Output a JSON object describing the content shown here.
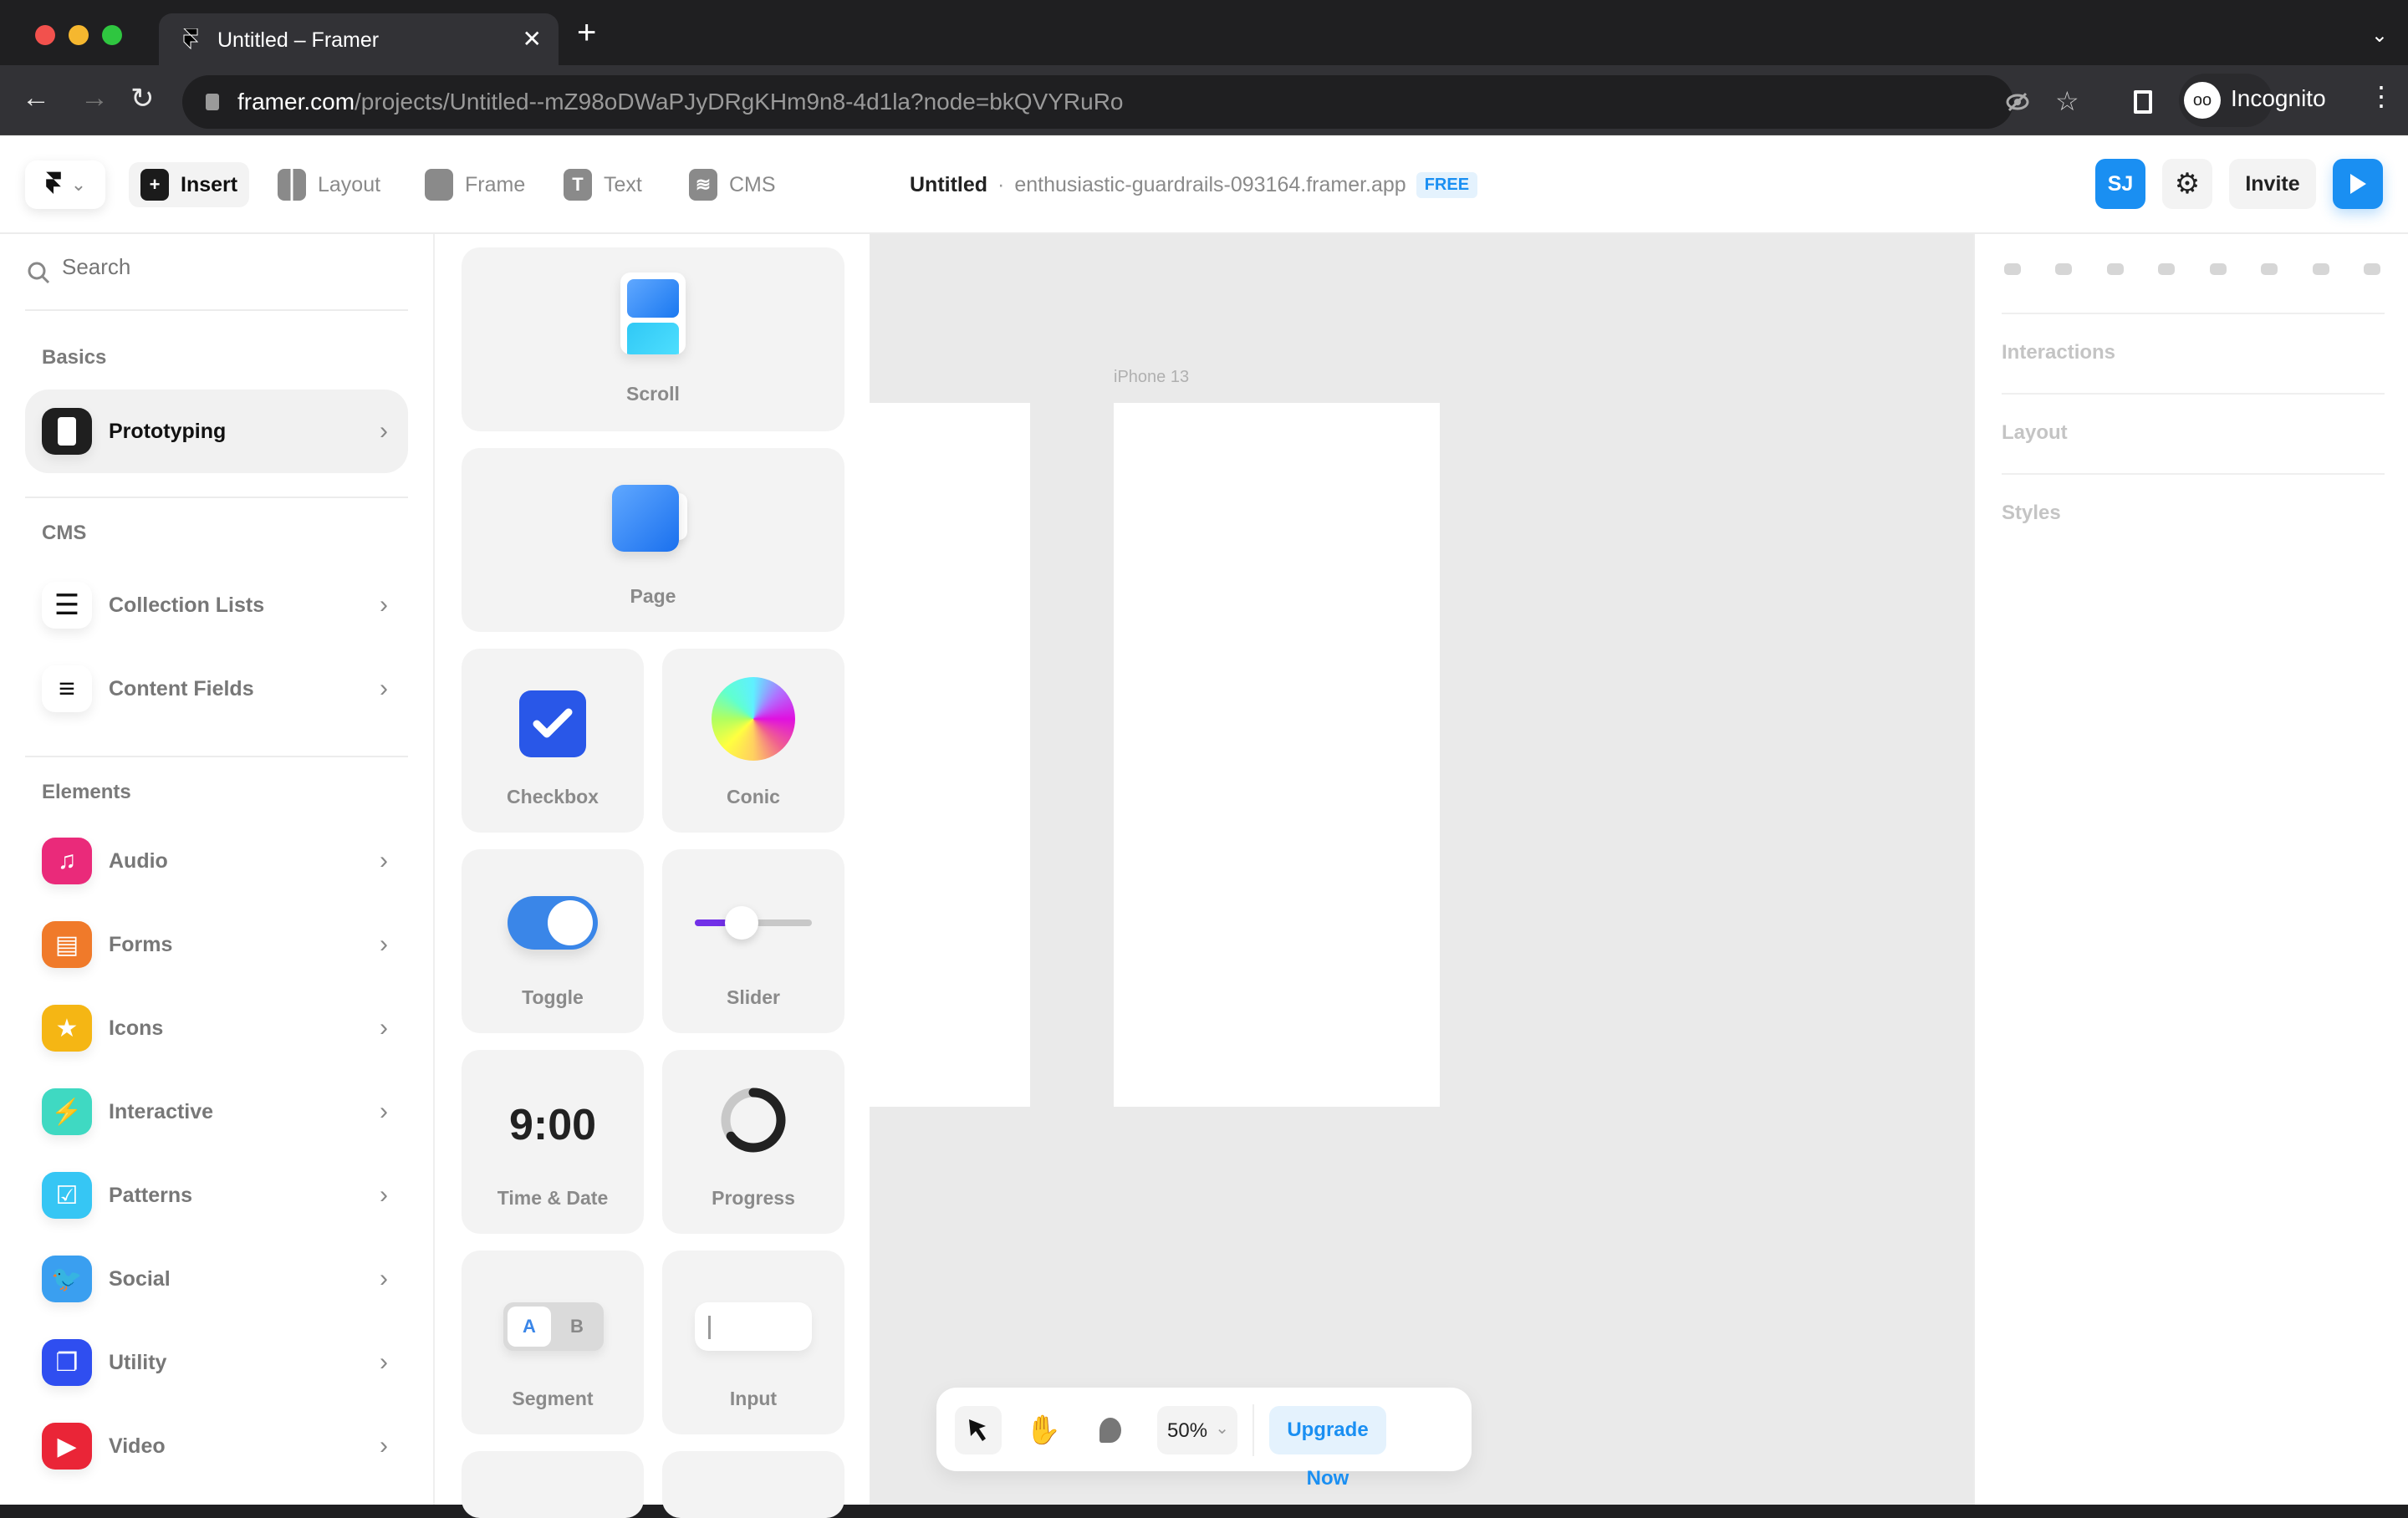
{
  "browser": {
    "tab_title": "Untitled – Framer",
    "url_host": "framer.com",
    "url_path": "/projects/Untitled--mZ98oDWaPJyDRgKHm9n8-4d1la?node=bkQVYRuRo",
    "profile_label": "Incognito",
    "icons": [
      "framer-favicon",
      "close-icon",
      "plus-icon",
      "chevron-down-icon",
      "back-icon",
      "forward-icon",
      "reload-icon",
      "lock-icon",
      "eye-off-icon",
      "star-icon",
      "sidebar-icon",
      "incognito-icon",
      "more-icon"
    ]
  },
  "topbar": {
    "insert": "Insert",
    "layout": "Layout",
    "frame": "Frame",
    "text": "Text",
    "cms": "CMS",
    "project_name": "Untitled",
    "separator": "·",
    "domain": "enthusiastic-guardrails-093164.framer.app",
    "plan_badge": "FREE",
    "avatar_initials": "SJ",
    "invite": "Invite",
    "accent": "#1a8ff2"
  },
  "sidebar": {
    "search_placeholder": "Search",
    "sections": {
      "basics": "Basics",
      "cms": "CMS",
      "elements": "Elements"
    },
    "basics_items": [
      {
        "label": "Prototyping",
        "icon": "phone-icon",
        "color": "#1f1f1f"
      }
    ],
    "cms_items": [
      {
        "label": "Collection Lists",
        "icon": "database-icon"
      },
      {
        "label": "Content Fields",
        "icon": "lines-icon"
      }
    ],
    "element_items": [
      {
        "label": "Audio",
        "icon": "music-icon",
        "color": "#ea2a7a"
      },
      {
        "label": "Forms",
        "icon": "form-icon",
        "color": "#f07a2a"
      },
      {
        "label": "Icons",
        "icon": "star-icon",
        "color": "#f5b614"
      },
      {
        "label": "Interactive",
        "icon": "bolt-icon",
        "color": "#3fd9c2"
      },
      {
        "label": "Patterns",
        "icon": "check-card-icon",
        "color": "#36c6f4"
      },
      {
        "label": "Social",
        "icon": "twitter-icon",
        "color": "#3a9ff0"
      },
      {
        "label": "Utility",
        "icon": "windows-icon",
        "color": "#2f4ef0"
      },
      {
        "label": "Video",
        "icon": "play-icon",
        "color": "#ea2537"
      }
    ]
  },
  "insert_panel": {
    "cards": [
      {
        "label": "Scroll"
      },
      {
        "label": "Page"
      },
      {
        "label": "Checkbox"
      },
      {
        "label": "Conic"
      },
      {
        "label": "Toggle"
      },
      {
        "label": "Slider"
      },
      {
        "label": "Time & Date",
        "preview": "9:00"
      },
      {
        "label": "Progress"
      },
      {
        "label": "Segment",
        "options": [
          "A",
          "B"
        ]
      },
      {
        "label": "Input"
      }
    ],
    "slider_value": 0.4,
    "progress_value": 0.65
  },
  "canvas": {
    "frame_label": "iPhone 13"
  },
  "right_panel": {
    "sections": [
      "Interactions",
      "Layout",
      "Styles"
    ],
    "align_icons": [
      "align-left-icon",
      "align-center-h-icon",
      "align-right-icon",
      "align-top-icon",
      "align-middle-v-icon",
      "align-bottom-icon",
      "distribute-h-icon",
      "distribute-v-icon"
    ]
  },
  "bottom_toolbar": {
    "zoom": "50%",
    "upgrade": "Upgrade Now"
  }
}
